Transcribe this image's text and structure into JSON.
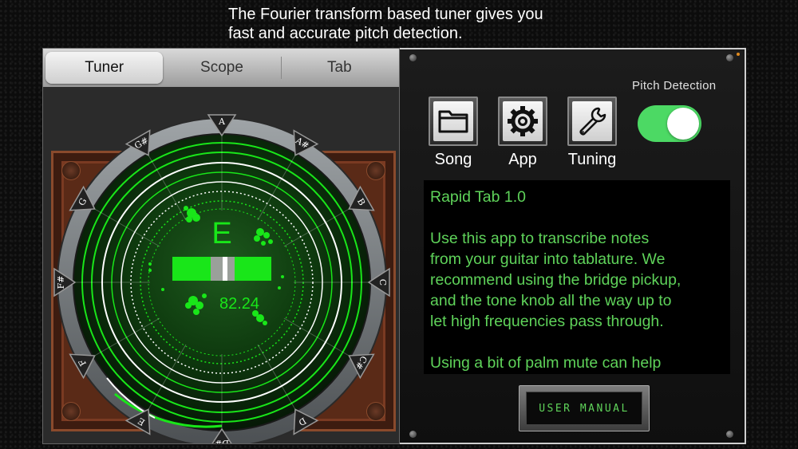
{
  "caption": {
    "line1": "The Fourier transform based tuner gives you",
    "line2": "fast and accurate pitch detection."
  },
  "tabs": [
    {
      "label": "Tuner",
      "active": true
    },
    {
      "label": "Scope",
      "active": false
    },
    {
      "label": "Tab",
      "active": false
    }
  ],
  "tuner": {
    "note": "E",
    "frequency": "82.24",
    "dial_notes": [
      "A",
      "A#",
      "B",
      "C",
      "C#",
      "D",
      "D#",
      "E",
      "F",
      "F#",
      "G",
      "G#"
    ],
    "accent_color": "#19e619"
  },
  "settings": {
    "buttons": [
      {
        "label": "Song",
        "icon": "folder-icon"
      },
      {
        "label": "App",
        "icon": "gear-icon"
      },
      {
        "label": "Tuning",
        "icon": "wrench-icon"
      }
    ],
    "pitch_detection_label": "Pitch Detection",
    "pitch_detection_on": true,
    "toggle_color": "#4cd964"
  },
  "info": {
    "title": "Rapid Tab 1.0",
    "paragraph1": "Use this app to transcribe notes\nfrom your guitar into tablature.  We\nrecommend using the bridge pickup,\nand the tone knob all the way up to\nlet high frequencies pass through.",
    "paragraph2": "Using a bit of palm mute can help",
    "text_color": "#5fd35a"
  },
  "manual_button_label": "USER MANUAL"
}
